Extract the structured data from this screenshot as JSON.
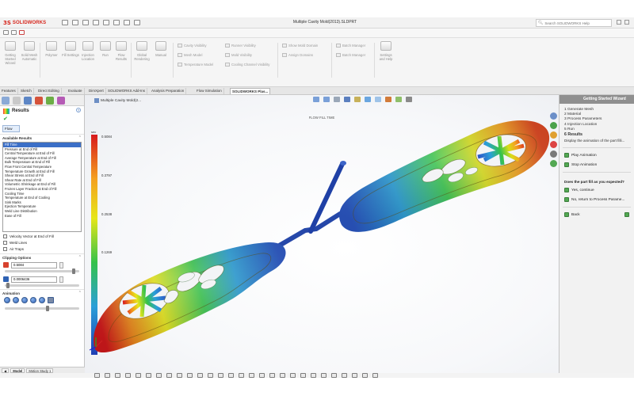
{
  "app": {
    "brand": "SOLIDWORKS",
    "window_title": "Multiple Cavity Mold(2013).SLDPRT",
    "search_placeholder": "Search SOLIDWORKS Help"
  },
  "ribbon": {
    "large_buttons": [
      {
        "label": "Getting Started Wizard"
      },
      {
        "label": "Solid Mesh Automatic"
      },
      {
        "label": "Polymer"
      },
      {
        "label": "Fill Settings"
      },
      {
        "label": "Injection Location"
      },
      {
        "label": "Run"
      },
      {
        "label": "Flow Results"
      },
      {
        "label": "Global Rendering"
      },
      {
        "label": "Manual"
      },
      {
        "label": "Settings and Help"
      }
    ],
    "small_buttons": [
      {
        "label": "Cavity Visibility"
      },
      {
        "label": "Mesh Model"
      },
      {
        "label": "Temperature Model"
      },
      {
        "label": "Runner Visibility"
      },
      {
        "label": "Mold Visibility"
      },
      {
        "label": "Cooling Channel Visibility"
      },
      {
        "label": "Show Mold Domain"
      },
      {
        "label": "Assign Domains"
      },
      {
        "label": "Batch Manager"
      },
      {
        "label": "Batch Manager"
      }
    ]
  },
  "command_tabs": [
    {
      "label": "Features"
    },
    {
      "label": "Sketch"
    },
    {
      "label": "Direct Editing"
    },
    {
      "label": "Evaluate"
    },
    {
      "label": "DimXpert"
    },
    {
      "label": "SOLIDWORKS Add-Ins"
    },
    {
      "label": "Analysis Preparation"
    },
    {
      "label": "Flow Simulation"
    },
    {
      "label": "SOLIDWORKS Plas..."
    }
  ],
  "left_panel": {
    "title": "Results",
    "flow_button": "Flow",
    "available_results_heading": "Available Results",
    "results": [
      "Fill Time",
      "Pressure at End of Fill",
      "Central Temperature at End of Fill",
      "Average Temperature at End of Fill",
      "Bulk Temperature at End of Fill",
      "Flow Front Central Temperature",
      "Temperature Growth at End of Fill",
      "Shear Stress at End of Fill",
      "Shear Rate at End of Fill",
      "Volumetric Shrinkage at End of Fill",
      "Frozen Layer Fraction at End of Fill",
      "Cooling Time",
      "Temperature at End of Cooling",
      "Sink Marks",
      "Ejection Temperature",
      "Weld Line Distribution",
      "Ease of Fill"
    ],
    "checkbox_velocity": "Velocity Vector at End of Fill",
    "checkbox_weld": "Weld Lines",
    "checkbox_air": "Air Traps",
    "clipping_heading": "Clipping Options",
    "clip_value_1": "0.5084",
    "clip_value_2": "0.0006436",
    "animation_heading": "Animation",
    "bottom_tabs": [
      "Model",
      "Motion Study 1"
    ]
  },
  "viewport": {
    "model_name": "Multiple Cavity Mold(2...",
    "view_title": "FLOW FILL TIME",
    "legend_unit": "sec",
    "legend_labels": [
      "0.5084",
      "0.3797",
      "0.2538",
      "0.1269",
      "0.0000"
    ],
    "colors": {
      "max": "#d7191c",
      "high": "#f4a020",
      "mid_high": "#e6e61a",
      "mid": "#35c24a",
      "low": "#2b9fd8",
      "min": "#1e3fb4"
    }
  },
  "right_panel": {
    "title": "Getting Started Wizard",
    "steps": [
      "1  Generate Mesh",
      "2  Material",
      "3  Process Parameters",
      "4  Injection Location",
      "5  Run",
      "6  Results"
    ],
    "current_step_index": 5,
    "description": "Display the animation of the part filli...",
    "play_button": "Play Animation",
    "stop_button": "Stop Animation",
    "question": "Does the part fill as you expected?",
    "yes_button": "Yes, continue",
    "no_button": "No, return to Process Parame...",
    "back_button": "Back"
  }
}
